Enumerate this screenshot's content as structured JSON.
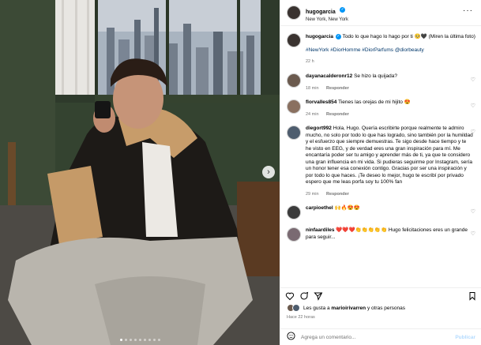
{
  "post": {
    "username": "hugogarcia",
    "verified": "✓",
    "location": "New York, New York",
    "caption_text": "Todo lo que hago lo hago por ti 🥺🖤 (Miren la última foto)",
    "hashtags": "#NewYork #DiorHomme #DiorParfums @diorbeauty",
    "caption_time": "22 h"
  },
  "comments": [
    {
      "user": "dayanacalderonr12",
      "text": "Se hizo la quijada?",
      "time": "18 min",
      "reply": "Responder"
    },
    {
      "user": "florvalles854",
      "text": "Tienes las orejas de mi hijito 😍",
      "time": "24 min",
      "reply": "Responder"
    },
    {
      "user": "diegort992",
      "text": "Hola, Hugo. Quería escribirte porque realmente te admiro mucho, no solo por todo lo que has logrado, sino también por la humildad y el esfuerzo que siempre demuestras. Te sigo desde hace tiempo y te he visto en EEG, y de verdad eres una gran inspiración para mí. Me encantaría poder ser tu amigo y aprender más de ti, ya que te considero una gran influencia en mi vida. Si pudieras seguirme por Instagram, sería un honor tener esa conexión contigo. Gracias por ser una inspiración y por todo lo que haces. ¡Te deseo lo mejor, hugo te escribí por privado espero que me leas porfa soy tu 100% fan",
      "time": "29 min",
      "reply": "Responder"
    },
    {
      "user": "carpioethel",
      "text": "🙌🔥😍😍",
      "time": "",
      "reply": ""
    },
    {
      "user": "ninfaardiles",
      "text": "❤️❤️❤️👏👏👏👏👏 Hugo felicitaciones eres un grande para seguir... ",
      "time": "",
      "reply": ""
    }
  ],
  "likes": {
    "text_prefix": "Les gusta a ",
    "user": "marioirivarren",
    "text_suffix": " y otras personas"
  },
  "date": "Hace 22 horas",
  "add_comment": {
    "placeholder": "Agrega un comentario...",
    "publish": "Publicar"
  },
  "icons": {
    "more": "more-options-icon",
    "heart": "heart-icon",
    "comment": "comment-icon",
    "share": "share-icon",
    "save": "bookmark-icon",
    "emoji": "emoji-icon",
    "next": "chevron-right-icon"
  }
}
